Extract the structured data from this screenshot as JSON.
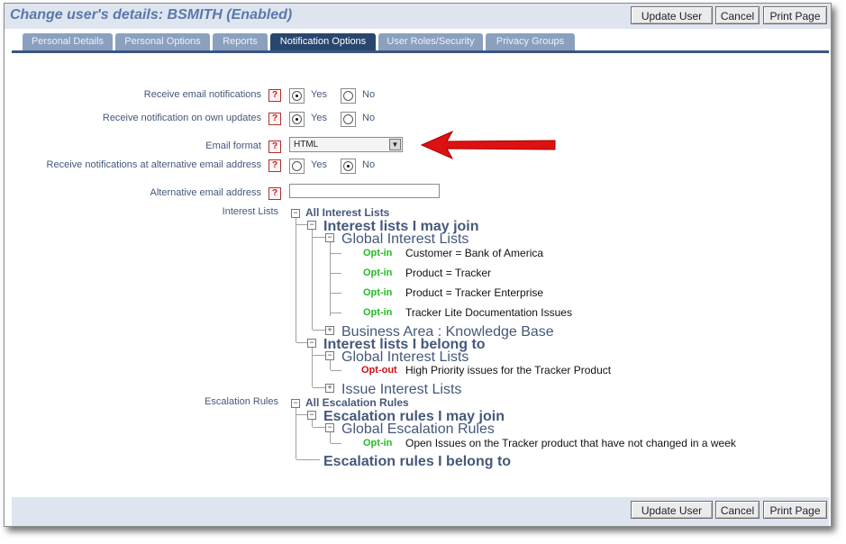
{
  "header": {
    "title": "Change user's details: BSMITH (Enabled)",
    "buttons": {
      "update": "Update User",
      "cancel": "Cancel",
      "print": "Print Page"
    }
  },
  "tabs": [
    {
      "label": "Personal Details"
    },
    {
      "label": "Personal Options"
    },
    {
      "label": "Reports"
    },
    {
      "label": "Notification Options",
      "active": true
    },
    {
      "label": "User Roles/Security"
    },
    {
      "label": "Privacy Groups"
    }
  ],
  "form": {
    "email_notifications": {
      "label": "Receive email notifications",
      "selected": "Yes",
      "yes": "Yes",
      "no": "No"
    },
    "own_updates": {
      "label": "Receive notification on own updates",
      "selected": "Yes",
      "yes": "Yes",
      "no": "No"
    },
    "email_format": {
      "label": "Email format",
      "value": "HTML"
    },
    "alt_address_notifications": {
      "label": "Receive notifications at alternative email address",
      "selected": "No",
      "yes": "Yes",
      "no": "No"
    },
    "alt_email": {
      "label": "Alternative email address",
      "value": ""
    },
    "help_glyph": "?"
  },
  "interest_lists": {
    "label": "Interest Lists",
    "root": "All Interest Lists",
    "may_join": "Interest lists I may join",
    "global_1": "Global Interest Lists",
    "items_join": [
      {
        "status": "Opt-in",
        "text": "Customer = Bank of America"
      },
      {
        "status": "Opt-in",
        "text": "Product = Tracker"
      },
      {
        "status": "Opt-in",
        "text": "Product = Tracker Enterprise"
      },
      {
        "status": "Opt-in",
        "text": "Tracker Lite Documentation Issues"
      }
    ],
    "business_area": "Business Area : Knowledge Base",
    "belong_to": "Interest lists I belong to",
    "global_2": "Global Interest Lists",
    "items_belong": [
      {
        "status": "Opt-out",
        "text": "High Priority issues for the Tracker Product"
      }
    ],
    "issue_interest": "Issue Interest Lists"
  },
  "escalation_rules": {
    "label": "Escalation Rules",
    "root": "All Escalation Rules",
    "may_join": "Escalation rules I may join",
    "global": "Global Escalation Rules",
    "items": [
      {
        "status": "Opt-in",
        "text": "Open Issues on the Tracker product that have not changed in a week"
      }
    ],
    "belong_to": "Escalation rules I belong to"
  },
  "footer": {
    "buttons": {
      "update": "Update User",
      "cancel": "Cancel",
      "print": "Print Page"
    }
  },
  "colors": {
    "title": "#5a78aa",
    "active_tab": "#28466e",
    "tab": "#8aa0be",
    "opt_in": "#22bb22",
    "opt_out": "#cc1111",
    "arrow": "#dd1111"
  }
}
